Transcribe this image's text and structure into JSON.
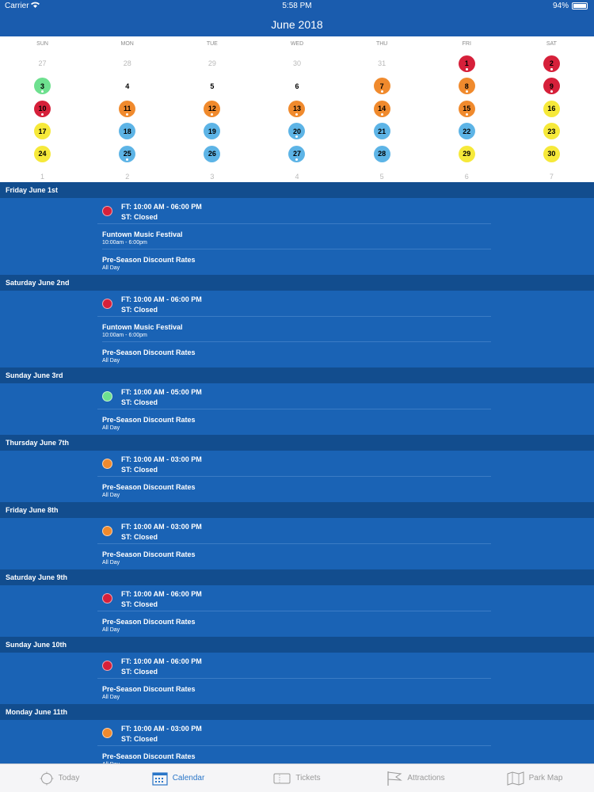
{
  "status": {
    "carrier": "Carrier",
    "time": "5:58 PM",
    "battery": "94%"
  },
  "nav": {
    "title": "June 2018"
  },
  "calendar": {
    "days_of_week": [
      "SUN",
      "MON",
      "TUE",
      "WED",
      "THU",
      "FRI",
      "SAT"
    ],
    "weeks": [
      [
        {
          "n": "27",
          "m": true
        },
        {
          "n": "28",
          "m": true
        },
        {
          "n": "29",
          "m": true
        },
        {
          "n": "30",
          "m": true
        },
        {
          "n": "31",
          "m": true
        },
        {
          "n": "1",
          "c": "#d6203a",
          "d": true
        },
        {
          "n": "2",
          "c": "#d6203a",
          "d": true
        }
      ],
      [
        {
          "n": "3",
          "c": "#6ee08f",
          "d": true
        },
        {
          "n": "4"
        },
        {
          "n": "5"
        },
        {
          "n": "6"
        },
        {
          "n": "7",
          "c": "#f08a2d",
          "d": true
        },
        {
          "n": "8",
          "c": "#f08a2d",
          "d": true
        },
        {
          "n": "9",
          "c": "#d6203a",
          "d": true
        }
      ],
      [
        {
          "n": "10",
          "c": "#d6203a",
          "d": true
        },
        {
          "n": "11",
          "c": "#f08a2d",
          "d": true
        },
        {
          "n": "12",
          "c": "#f08a2d",
          "d": true
        },
        {
          "n": "13",
          "c": "#f08a2d",
          "d": true
        },
        {
          "n": "14",
          "c": "#f08a2d",
          "d": true
        },
        {
          "n": "15",
          "c": "#f08a2d",
          "d": true
        },
        {
          "n": "16",
          "c": "#f6e93a"
        }
      ],
      [
        {
          "n": "17",
          "c": "#f6e93a"
        },
        {
          "n": "18",
          "c": "#5db4e6"
        },
        {
          "n": "19",
          "c": "#5db4e6"
        },
        {
          "n": "20",
          "c": "#5db4e6",
          "d": true
        },
        {
          "n": "21",
          "c": "#5db4e6"
        },
        {
          "n": "22",
          "c": "#5db4e6"
        },
        {
          "n": "23",
          "c": "#f6e93a"
        }
      ],
      [
        {
          "n": "24",
          "c": "#f6e93a"
        },
        {
          "n": "25",
          "c": "#5db4e6",
          "d": true
        },
        {
          "n": "26",
          "c": "#5db4e6"
        },
        {
          "n": "27",
          "c": "#5db4e6",
          "d": true
        },
        {
          "n": "28",
          "c": "#5db4e6"
        },
        {
          "n": "29",
          "c": "#f6e93a"
        },
        {
          "n": "30",
          "c": "#f6e93a"
        }
      ],
      [
        {
          "n": "1",
          "m": true
        },
        {
          "n": "2",
          "m": true
        },
        {
          "n": "3",
          "m": true
        },
        {
          "n": "4",
          "m": true
        },
        {
          "n": "5",
          "m": true
        },
        {
          "n": "6",
          "m": true
        },
        {
          "n": "7",
          "m": true
        }
      ]
    ]
  },
  "sections": [
    {
      "header": "Friday June 1st",
      "hours_color": "#d6203a",
      "ft": "FT: 10:00 AM - 06:00 PM",
      "st": "ST: Closed",
      "items": [
        {
          "name": "Funtown Music Festival",
          "time": "10:00am - 6:00pm"
        },
        {
          "name": "Pre-Season Discount Rates",
          "time": "All Day"
        }
      ]
    },
    {
      "header": "Saturday June 2nd",
      "hours_color": "#d6203a",
      "ft": "FT: 10:00 AM - 06:00 PM",
      "st": "ST: Closed",
      "items": [
        {
          "name": "Funtown Music Festival",
          "time": "10:00am - 6:00pm"
        },
        {
          "name": "Pre-Season Discount Rates",
          "time": "All Day"
        }
      ]
    },
    {
      "header": "Sunday June 3rd",
      "hours_color": "#6ee08f",
      "ft": "FT: 10:00 AM - 05:00 PM",
      "st": "ST: Closed",
      "items": [
        {
          "name": "Pre-Season Discount Rates",
          "time": "All Day"
        }
      ]
    },
    {
      "header": "Thursday June 7th",
      "hours_color": "#f08a2d",
      "ft": "FT: 10:00 AM - 03:00 PM",
      "st": "ST: Closed",
      "items": [
        {
          "name": "Pre-Season Discount Rates",
          "time": "All Day"
        }
      ]
    },
    {
      "header": "Friday June 8th",
      "hours_color": "#f08a2d",
      "ft": "FT: 10:00 AM - 03:00 PM",
      "st": "ST: Closed",
      "items": [
        {
          "name": "Pre-Season Discount Rates",
          "time": "All Day"
        }
      ]
    },
    {
      "header": "Saturday June 9th",
      "hours_color": "#d6203a",
      "ft": "FT: 10:00 AM - 06:00 PM",
      "st": "ST: Closed",
      "items": [
        {
          "name": "Pre-Season Discount Rates",
          "time": "All Day"
        }
      ]
    },
    {
      "header": "Sunday June 10th",
      "hours_color": "#d6203a",
      "ft": "FT: 10:00 AM - 06:00 PM",
      "st": "ST: Closed",
      "items": [
        {
          "name": "Pre-Season Discount Rates",
          "time": "All Day"
        }
      ]
    },
    {
      "header": "Monday June 11th",
      "hours_color": "#f08a2d",
      "ft": "FT: 10:00 AM - 03:00 PM",
      "st": "ST: Closed",
      "items": [
        {
          "name": "Pre-Season Discount Rates",
          "time": "All Day"
        }
      ]
    }
  ],
  "tabbar": [
    {
      "label": "Today",
      "icon": "sun-icon",
      "active": false
    },
    {
      "label": "Calendar",
      "icon": "calendar-icon",
      "active": true
    },
    {
      "label": "Tickets",
      "icon": "ticket-icon",
      "active": false
    },
    {
      "label": "Attractions",
      "icon": "flag-icon",
      "active": false
    },
    {
      "label": "Park Map",
      "icon": "map-icon",
      "active": false
    }
  ],
  "colors": {
    "nav": "#1a5cae",
    "section_header": "#124d8e",
    "section_body": "#1a63b5",
    "tab_active": "#2a76c8"
  }
}
